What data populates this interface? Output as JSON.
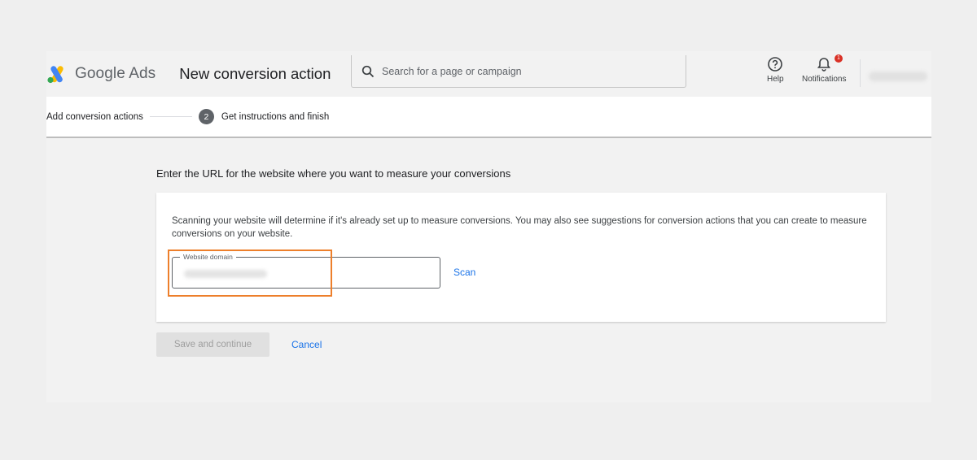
{
  "header": {
    "brand": "Google Ads",
    "page_title": "New conversion action",
    "search_placeholder": "Search for a page or campaign",
    "help_label": "Help",
    "notifications_label": "Notifications",
    "notifications_count": "1"
  },
  "stepper": {
    "step1_label": "Add conversion actions",
    "step2_number": "2",
    "step2_label": "Get instructions and finish"
  },
  "main": {
    "section_title": "Enter the URL for the website where you want to measure your conversions",
    "description": "Scanning your website will determine if it's already set up to measure conversions. You may also see suggestions for conversion actions that you can create to measure conversions on your website.",
    "field_label": "Website domain",
    "scan_label": "Scan",
    "save_label": "Save and continue",
    "cancel_label": "Cancel"
  },
  "colors": {
    "highlight": "#ed7f2b",
    "link": "#1a73e8",
    "badge": "#d93025"
  },
  "icons": [
    "google-ads-logo-icon",
    "search-icon",
    "help-icon",
    "bell-icon"
  ]
}
